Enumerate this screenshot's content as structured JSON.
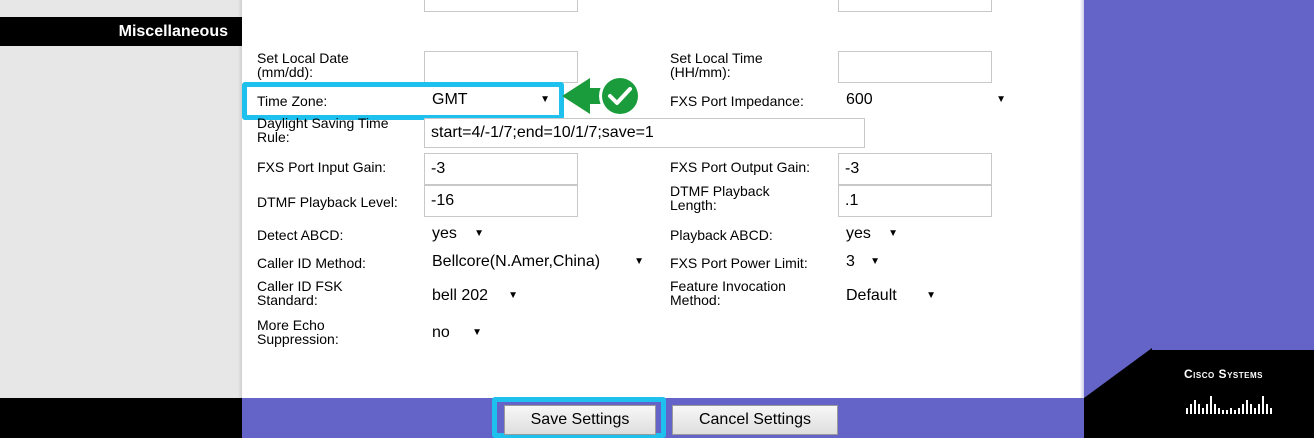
{
  "sidebar": {
    "section_title": "Miscellaneous"
  },
  "form": {
    "set_local_date": {
      "label_line1": "Set Local Date",
      "label_line2": "(mm/dd):",
      "value": ""
    },
    "set_local_time": {
      "label_line1": "Set Local Time",
      "label_line2": "(HH/mm):",
      "value": ""
    },
    "time_zone": {
      "label": "Time Zone:",
      "value": "GMT"
    },
    "fxs_port_impedance": {
      "label": "FXS Port Impedance:",
      "value": "600"
    },
    "daylight_saving": {
      "label_line1": "Daylight Saving Time",
      "label_line2": "Rule:",
      "value": "start=4/-1/7;end=10/1/7;save=1"
    },
    "fxs_input_gain": {
      "label": "FXS Port Input Gain:",
      "value": "-3"
    },
    "fxs_output_gain": {
      "label": "FXS Port Output Gain:",
      "value": "-3"
    },
    "dtmf_playback_level": {
      "label": "DTMF Playback Level:",
      "value": "-16"
    },
    "dtmf_playback_length": {
      "label_line1": "DTMF Playback",
      "label_line2": "Length:",
      "value": ".1"
    },
    "detect_abcd": {
      "label": "Detect ABCD:",
      "value": "yes"
    },
    "playback_abcd": {
      "label": "Playback ABCD:",
      "value": "yes"
    },
    "caller_id_method": {
      "label": "Caller ID Method:",
      "value": "Bellcore(N.Amer,China)"
    },
    "fxs_power_limit": {
      "label": "FXS Port Power Limit:",
      "value": "3"
    },
    "caller_id_fsk": {
      "label_line1": "Caller ID FSK",
      "label_line2": "Standard:",
      "value": "bell 202"
    },
    "feature_invocation": {
      "label_line1": "Feature Invocation",
      "label_line2": "Method:",
      "value": "Default"
    },
    "echo_suppression": {
      "label_line1": "More Echo",
      "label_line2": "Suppression:",
      "value": "no"
    }
  },
  "buttons": {
    "save": "Save Settings",
    "cancel": "Cancel Settings"
  },
  "brand": {
    "logo_text": "Cisco Systems"
  },
  "colors": {
    "highlight": "#1ec0ee",
    "check_green": "#1a9c3c",
    "panel_purple": "#6464c8"
  },
  "icons": {
    "dropdown": "chevron-down-icon",
    "check": "check-circle-icon"
  }
}
